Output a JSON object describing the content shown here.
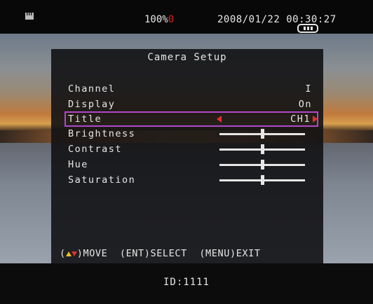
{
  "status_bar": {
    "battery_value": "100%",
    "battery_warn_glyph": "0",
    "datetime": "2008/01/22 00:30:27",
    "left_icon": "sd-card-icon",
    "record_icon": "recording-icon"
  },
  "menu": {
    "title": "Camera Setup",
    "items": [
      {
        "label": "Channel",
        "value": "I",
        "type": "text"
      },
      {
        "label": "Display",
        "value": "On",
        "type": "text"
      },
      {
        "label": "Title",
        "value": "CH1",
        "type": "select",
        "selected": true
      },
      {
        "label": "Brightness",
        "type": "slider",
        "level": 0.5
      },
      {
        "label": "Contrast",
        "type": "slider",
        "level": 0.5
      },
      {
        "label": "Hue",
        "type": "slider",
        "level": 0.5
      },
      {
        "label": "Saturation",
        "type": "slider",
        "level": 0.5
      }
    ],
    "hint": {
      "open_paren": "(",
      "move": ")MOVE",
      "select": "(ENT)SELECT",
      "exit": "(MENU)EXIT"
    }
  },
  "footer": {
    "device_id": "ID:1111"
  },
  "colors": {
    "highlight": "#b048c8",
    "arrow": "#e03030",
    "text": "#e6e6e6"
  }
}
